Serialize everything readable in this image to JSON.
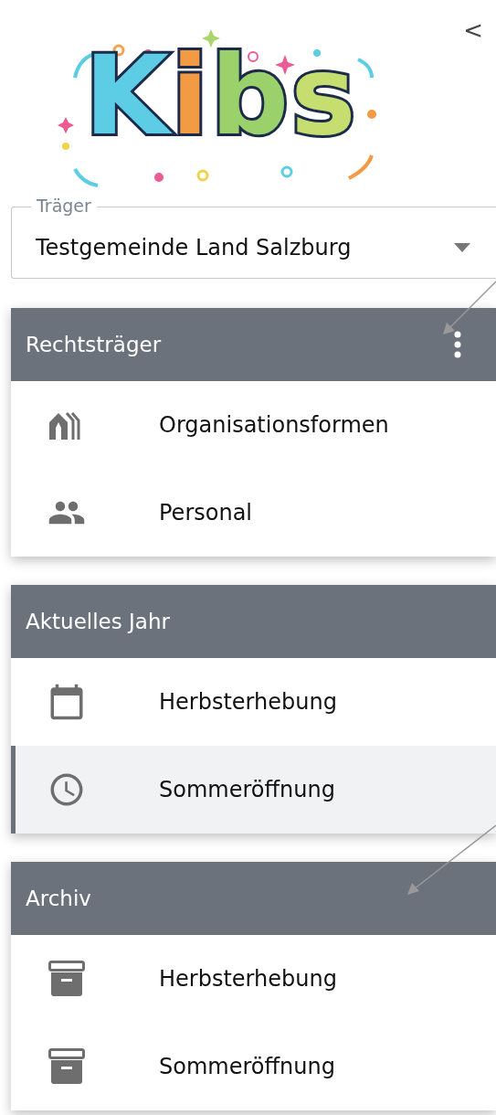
{
  "logo": {
    "text": "Kibs"
  },
  "collapse_button": {
    "label": "<"
  },
  "carrier_select": {
    "label": "Träger",
    "value": "Testgemeinde Land Salzburg"
  },
  "sections": [
    {
      "title": "Rechtsträger",
      "has_menu": true,
      "items": [
        {
          "kind": "buildings",
          "label": "Organisationsformen",
          "selected": false
        },
        {
          "kind": "people",
          "label": "Personal",
          "selected": false
        }
      ]
    },
    {
      "title": "Aktuelles Jahr",
      "has_menu": false,
      "items": [
        {
          "kind": "calendar",
          "label": "Herbsterhebung",
          "selected": false
        },
        {
          "kind": "clock",
          "label": "Sommeröffnung",
          "selected": true
        }
      ]
    },
    {
      "title": "Archiv",
      "has_menu": false,
      "items": [
        {
          "kind": "archive",
          "label": "Herbsterhebung",
          "selected": false
        },
        {
          "kind": "archive",
          "label": "Sommeröffnung",
          "selected": false
        }
      ]
    }
  ]
}
